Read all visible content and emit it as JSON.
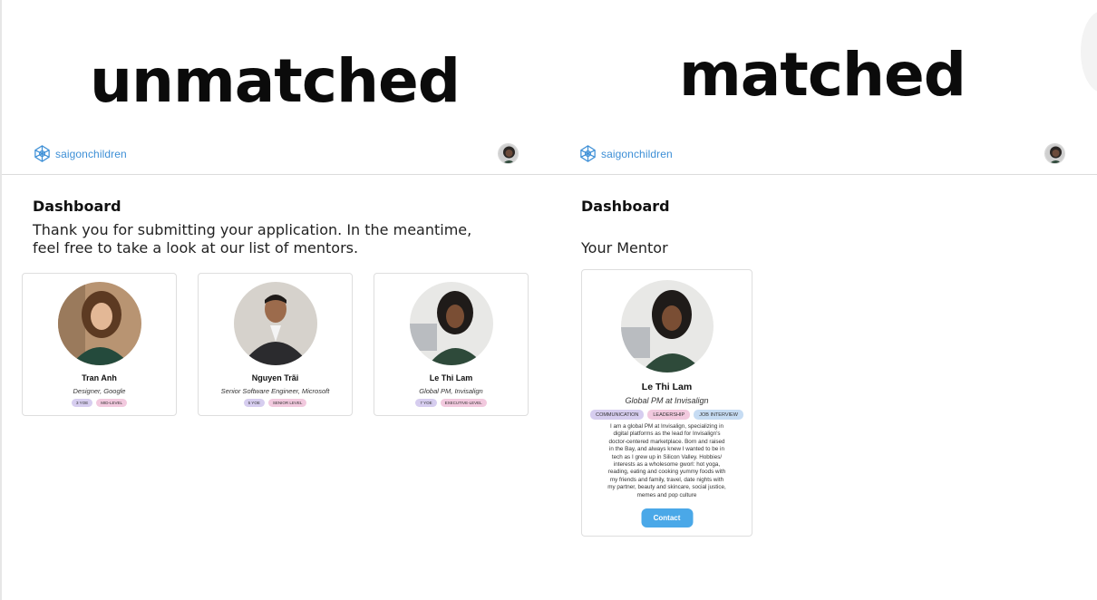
{
  "headings": {
    "left": "unmatched",
    "right": "matched"
  },
  "brand": {
    "logo_text": "saigonchildren",
    "accent": "#3d8fd6"
  },
  "unmatched": {
    "dashboard_title": "Dashboard",
    "message_line1": "Thank you for submitting your application. In the meantime,",
    "message_line2": "feel free to take a look at our list of mentors.",
    "mentors": [
      {
        "name": "Tran Anh",
        "role": "Designer, Google",
        "tags": [
          "3 YOE",
          "MID-LEVEL"
        ]
      },
      {
        "name": "Nguyen Trãi",
        "role": "Senior Software Engineer, Microsoft",
        "tags": [
          "5 YOE",
          "SENIOR LEVEL"
        ]
      },
      {
        "name": "Le Thi Lam",
        "role": "Global PM, Invisalign",
        "tags": [
          "7 YOE",
          "EXECUTIVE-LEVEL"
        ]
      }
    ]
  },
  "matched": {
    "dashboard_title": "Dashboard",
    "section_label": "Your Mentor",
    "mentor": {
      "name": "Le Thi Lam",
      "role": "Global PM at Invisalign",
      "tags": [
        "COMMUNICATION",
        "LEADERSHIP",
        "JOB INTERVIEW"
      ],
      "bio_lines": [
        "I am a global PM at Invisalign, specializing in",
        "digital platforms as the lead for Invisalign's",
        "doctor-centered marketplace. Born and raised",
        "in the Bay, and always knew I wanted to be in",
        "tech as I grew up in Silicon Valley. Hobbies/",
        "interests as a wholesome gworl: hot yoga,",
        "reading, eating and cooking yummy foods with",
        "my friends and family, travel, date nights with",
        "my partner, beauty and skincare, social justice,",
        "memes and pop culture"
      ],
      "contact_label": "Contact"
    }
  },
  "icons": {
    "logo": "saigonchildren-logo-icon",
    "avatar": "user-avatar"
  }
}
